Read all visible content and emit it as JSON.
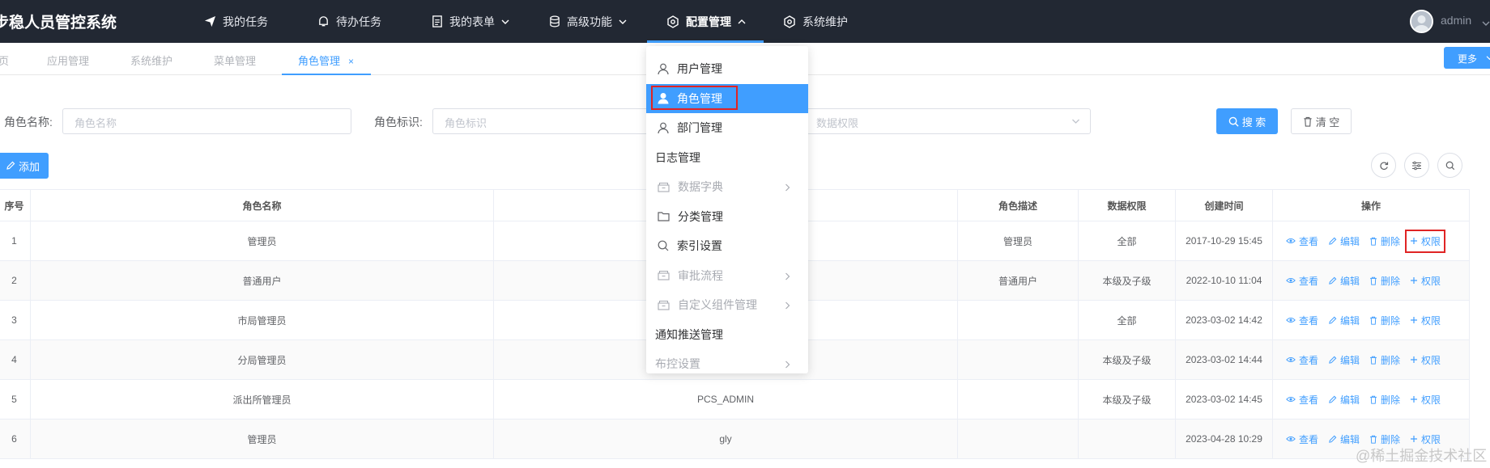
{
  "app": {
    "title": "步稳人员管控系统",
    "user": "admin"
  },
  "nav": [
    {
      "label": "我的任务",
      "icon": "send-icon"
    },
    {
      "label": "待办任务",
      "icon": "bell-icon"
    },
    {
      "label": "我的表单",
      "icon": "document-icon"
    },
    {
      "label": "高级功能",
      "icon": "database-icon"
    },
    {
      "label": "配置管理",
      "icon": "gear-icon"
    },
    {
      "label": "系统维护",
      "icon": "gear-icon"
    }
  ],
  "tabs": [
    "页",
    "应用管理",
    "系统维护",
    "菜单管理",
    "角色管理"
  ],
  "more_label": "更多",
  "filters": {
    "role_name_label": "角色名称:",
    "role_name_placeholder": "角色名称",
    "role_key_label": "角色标识:",
    "role_key_placeholder": "角色标识",
    "data_scope_placeholder": "数据权限",
    "search_label": "搜 索",
    "clear_label": "清 空"
  },
  "add_label": "添加",
  "table": {
    "headers": [
      "序号",
      "角色名称",
      "",
      "角色描述",
      "数据权限",
      "创建时间",
      "操作"
    ],
    "rows": [
      {
        "no": "1",
        "name": "管理员",
        "key": "",
        "desc": "管理员",
        "scope": "全部",
        "created": "2017-10-29 15:45"
      },
      {
        "no": "2",
        "name": "普通用户",
        "key": "",
        "desc": "普通用户",
        "scope": "本级及子级",
        "created": "2022-10-10 11:04"
      },
      {
        "no": "3",
        "name": "市局管理员",
        "key": "",
        "desc": "",
        "scope": "全部",
        "created": "2023-03-02 14:42"
      },
      {
        "no": "4",
        "name": "分局管理员",
        "key": "",
        "desc": "",
        "scope": "本级及子级",
        "created": "2023-03-02 14:44"
      },
      {
        "no": "5",
        "name": "派出所管理员",
        "key": "PCS_ADMIN",
        "desc": "",
        "scope": "本级及子级",
        "created": "2023-03-02 14:45"
      },
      {
        "no": "6",
        "name": "管理员",
        "key": "gly",
        "desc": "",
        "scope": "",
        "created": "2023-04-28 10:29"
      }
    ],
    "ops": {
      "view": "查看",
      "edit": "编辑",
      "delete": "删除",
      "perm": "权限"
    }
  },
  "dropdown": [
    {
      "label": "用户管理",
      "icon": "user-icon",
      "state": "normal"
    },
    {
      "label": "角色管理",
      "icon": "user-filled-icon",
      "state": "active"
    },
    {
      "label": "部门管理",
      "icon": "user-icon",
      "state": "normal"
    },
    {
      "label": "日志管理",
      "icon": "",
      "state": "plain"
    },
    {
      "label": "数据字典",
      "icon": "box-icon",
      "state": "disabled",
      "submenu": true
    },
    {
      "label": "分类管理",
      "icon": "folder-icon",
      "state": "normal"
    },
    {
      "label": "索引设置",
      "icon": "search-icon",
      "state": "normal"
    },
    {
      "label": "审批流程",
      "icon": "box-icon",
      "state": "disabled",
      "submenu": true
    },
    {
      "label": "自定义组件管理",
      "icon": "box-icon",
      "state": "disabled",
      "submenu": true
    },
    {
      "label": "通知推送管理",
      "icon": "",
      "state": "plain"
    },
    {
      "label": "布控设置",
      "icon": "",
      "state": "disabled-plain",
      "submenu": true
    }
  ],
  "watermark": "@稀土掘金技术社区"
}
